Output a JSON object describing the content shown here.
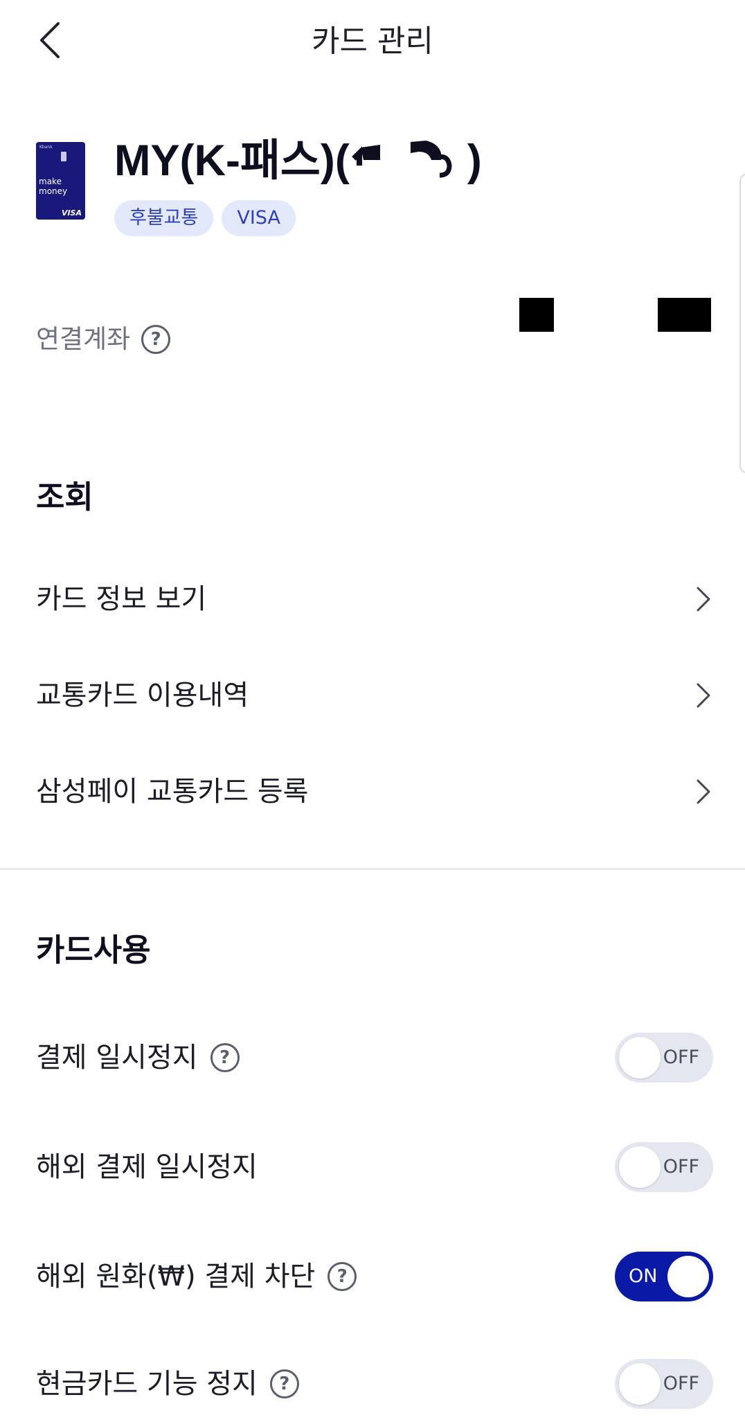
{
  "header": {
    "title": "카드 관리",
    "back_icon": "chevron-left-icon"
  },
  "card": {
    "image": {
      "brand_text": "Kbank",
      "tagline": "make money",
      "network": "VISA",
      "color": "#18197a"
    },
    "name": "MY(K-패스)(",
    "tags": [
      "후불교통",
      "VISA"
    ]
  },
  "linked_account": {
    "label": "연결계좌"
  },
  "sections": {
    "inquiry": {
      "title": "조회",
      "items": [
        {
          "label": "카드 정보 보기"
        },
        {
          "label": "교통카드 이용내역"
        },
        {
          "label": "삼성페이 교통카드 등록"
        }
      ]
    },
    "card_usage": {
      "title": "카드사용",
      "toggles": [
        {
          "label": "결제 일시정지",
          "help": true,
          "state": "OFF"
        },
        {
          "label": "해외 결제 일시정지",
          "help": false,
          "state": "OFF"
        },
        {
          "label": "해외 원화(₩) 결제 차단",
          "help": true,
          "state": "ON"
        },
        {
          "label": "현금카드 기능 정지",
          "help": true,
          "state": "OFF"
        }
      ]
    }
  },
  "colors": {
    "accent": "#0a1aa6",
    "tag_bg": "#e4e8fb",
    "tag_text": "#2f3fb8",
    "toggle_off_bg": "#e4e7f0"
  }
}
